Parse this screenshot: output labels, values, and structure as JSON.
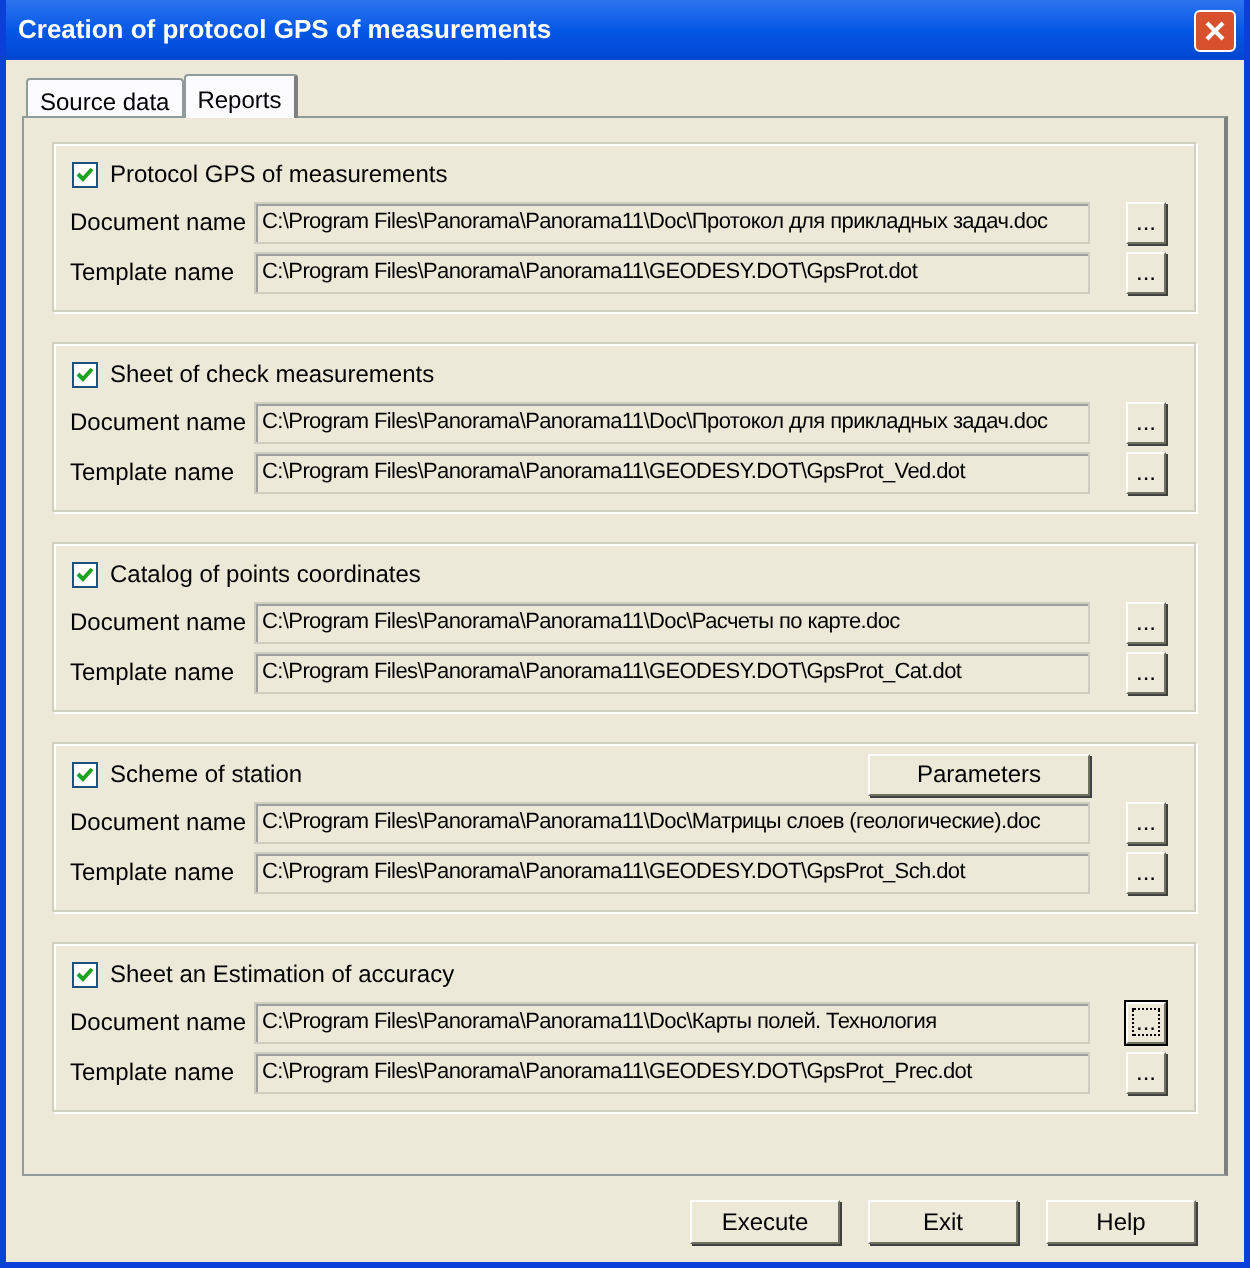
{
  "window": {
    "title": "Creation of protocol GPS of measurements"
  },
  "tabs": [
    {
      "label": "Source data",
      "selected": false
    },
    {
      "label": "Reports",
      "selected": true
    }
  ],
  "groups": [
    {
      "label": "Protocol GPS of measurements",
      "checked": true,
      "fields": [
        {
          "label": "Document name",
          "value": "C:\\Program Files\\Panorama\\Panorama11\\Doc\\Протокол для прикладных задач.doc",
          "focused": false
        },
        {
          "label": "Template name",
          "value": "C:\\Program Files\\Panorama\\Panorama11\\GEODESY.DOT\\GpsProt.dot",
          "focused": false
        }
      ]
    },
    {
      "label": "Sheet of check measurements",
      "checked": true,
      "fields": [
        {
          "label": "Document name",
          "value": "C:\\Program Files\\Panorama\\Panorama11\\Doc\\Протокол для прикладных задач.doc",
          "focused": false
        },
        {
          "label": "Template name",
          "value": "C:\\Program Files\\Panorama\\Panorama11\\GEODESY.DOT\\GpsProt_Ved.dot",
          "focused": false
        }
      ]
    },
    {
      "label": "Catalog of points coordinates",
      "checked": true,
      "fields": [
        {
          "label": "Document name",
          "value": "C:\\Program Files\\Panorama\\Panorama11\\Doc\\Расчеты по карте.doc",
          "focused": false
        },
        {
          "label": "Template name",
          "value": "C:\\Program Files\\Panorama\\Panorama11\\GEODESY.DOT\\GpsProt_Cat.dot",
          "focused": false
        }
      ]
    },
    {
      "label": "Scheme of station",
      "checked": true,
      "action": "Parameters",
      "fields": [
        {
          "label": "Document name",
          "value": "C:\\Program Files\\Panorama\\Panorama11\\Doc\\Матрицы слоев (геологические).doc",
          "focused": false
        },
        {
          "label": "Template name",
          "value": "C:\\Program Files\\Panorama\\Panorama11\\GEODESY.DOT\\GpsProt_Sch.dot",
          "focused": false
        }
      ]
    },
    {
      "label": "Sheet an Estimation of accuracy",
      "checked": true,
      "fields": [
        {
          "label": "Document name",
          "value": "C:\\Program Files\\Panorama\\Panorama11\\Doc\\Карты полей. Технология",
          "focused": true
        },
        {
          "label": "Template name",
          "value": "C:\\Program Files\\Panorama\\Panorama11\\GEODESY.DOT\\GpsProt_Prec.dot",
          "focused": false
        }
      ]
    }
  ],
  "browse_label": "...",
  "buttons": [
    "Execute",
    "Exit",
    "Help"
  ]
}
